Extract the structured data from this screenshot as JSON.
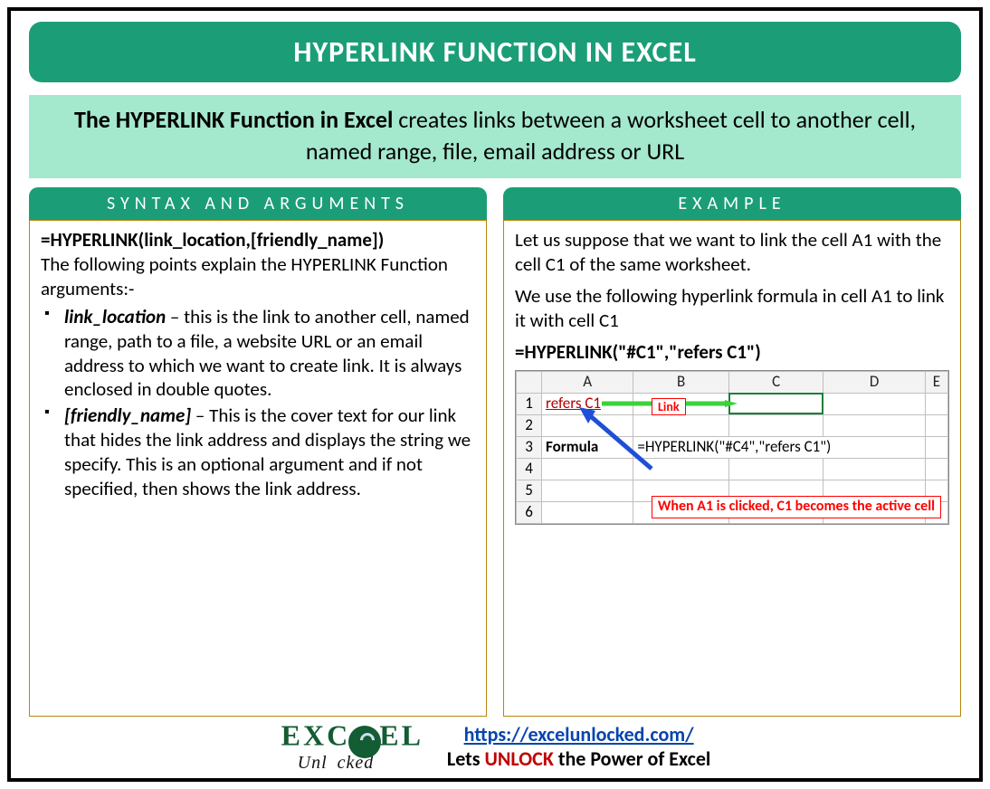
{
  "title": "HYPERLINK FUNCTION IN EXCEL",
  "intro_bold": "The HYPERLINK Function in Excel",
  "intro_rest": " creates links between a worksheet cell to another cell, named range, file, email address or URL",
  "left": {
    "heading": "SYNTAX AND ARGUMENTS",
    "syntax": "=HYPERLINK(link_location,[friendly_name])",
    "lead": "The following points explain the HYPERLINK Function arguments:-",
    "args": [
      {
        "name": "link_location",
        "dash": " – ",
        "desc": "this is the link to another cell, named range, path to a file, a website URL or an email address to which we want to create link. It is always enclosed in double quotes."
      },
      {
        "name": "[friendly_name]",
        "dash": " – ",
        "desc": "This is the cover text for our link that hides the link address and displays the string we specify. This is an optional argument and if not specified, then shows the link address."
      }
    ]
  },
  "right": {
    "heading": "EXAMPLE",
    "p1": "Let us suppose that we want to link the cell A1 with the cell C1 of the same worksheet.",
    "p2": "We use the following hyperlink formula in cell A1 to link it with cell C1",
    "formula": "=HYPERLINK(\"#C1\",\"refers C1\")",
    "sheet": {
      "cols": [
        "A",
        "B",
        "C",
        "D",
        "E"
      ],
      "rows": [
        "1",
        "2",
        "3",
        "4",
        "5",
        "6"
      ],
      "a1": "refers C1",
      "formula_label": "Formula",
      "formula_cell": "=HYPERLINK(\"#C4\",\"refers C1\")",
      "link_tag": "Link",
      "callout": "When A1 is clicked, C1 becomes the active cell"
    }
  },
  "footer": {
    "logo_top": "EXC  EL",
    "logo_bot": "Unl   cked",
    "url": "https://excelunlocked.com/",
    "tag_pre": "Lets ",
    "tag_unlock": "UNLOCK",
    "tag_post": " the Power of Excel"
  }
}
